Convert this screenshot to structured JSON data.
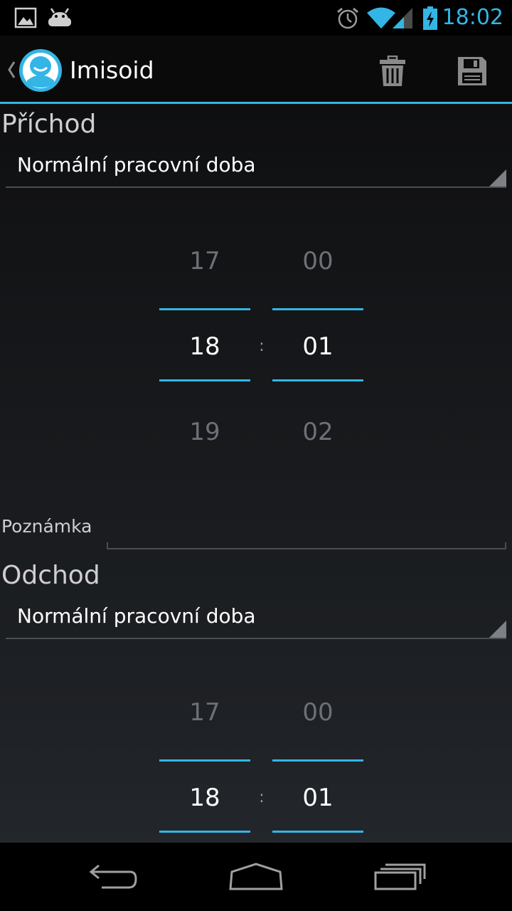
{
  "status_bar": {
    "time": "18:02",
    "icons": [
      "image-notification-icon",
      "android-debug-icon",
      "alarm-icon",
      "wifi-icon",
      "signal-icon",
      "battery-charging-icon"
    ]
  },
  "action_bar": {
    "title": "Imisoid",
    "actions": [
      "delete-icon",
      "save-icon"
    ]
  },
  "arrival": {
    "title": "Příchod",
    "spinner_value": "Normální pracovní doba",
    "hour_prev": "17",
    "hour_current": "18",
    "hour_next": "19",
    "minute_prev": "00",
    "minute_current": "01",
    "minute_next": "02",
    "separator": ":"
  },
  "note": {
    "label": "Poznámka",
    "value": ""
  },
  "departure": {
    "title": "Odchod",
    "spinner_value": "Normální pracovní doba",
    "hour_prev": "17",
    "hour_current": "18",
    "minute_prev": "00",
    "minute_current": "01",
    "separator": ":"
  },
  "nav_bar": {
    "buttons": [
      "back-icon",
      "home-icon",
      "recent-apps-icon"
    ]
  },
  "colors": {
    "accent": "#33b5e5",
    "background": "#121315",
    "text_primary": "#ffffff",
    "text_dim": "#6d7075"
  }
}
